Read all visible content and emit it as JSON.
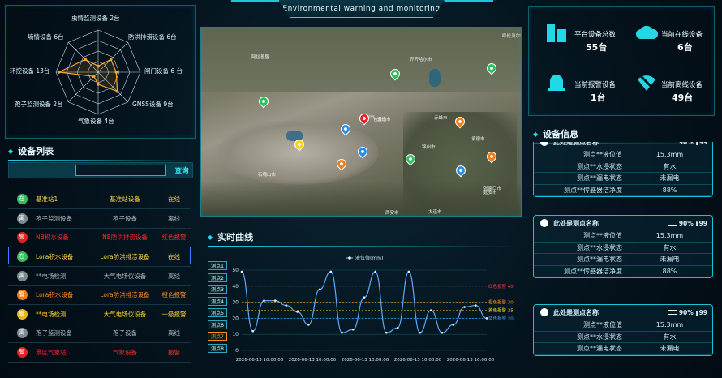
{
  "header": {
    "title": "Environmental warning and monitoring"
  },
  "radar": {
    "labels": [
      "虫情监测设备 2台",
      "防洪排涝设备 6台",
      "闸门设备 6 台",
      "GNSS设备 9台",
      "气象设备 4台",
      "孢子监测设备 2台",
      "环控设备 13台",
      "墒情设备 6台"
    ],
    "values": [
      2,
      6,
      6,
      9,
      4,
      2,
      13,
      6
    ],
    "max": 14
  },
  "device_list": {
    "title": "设备列表",
    "search_button": "查询",
    "search_placeholder": "",
    "rows": [
      {
        "badge": "在",
        "name": "基准站1",
        "type": "基准站设备",
        "status": "在线",
        "color": "#ffd34a",
        "badge_color": "#2fbf5e"
      },
      {
        "badge": "离",
        "name": "孢子监测设备",
        "type": "孢子设备",
        "status": "离线",
        "color": "#a9b6bc",
        "badge_color": "#7d8a90"
      },
      {
        "badge": "警",
        "name": "NB积水设备",
        "type": "NB防洪排涝设备",
        "status": "红色报警",
        "color": "#ff2a2a",
        "badge_color": "#e02424"
      },
      {
        "badge": "在",
        "name": "Lora积水设备",
        "type": "Lora防洪排涝设备",
        "status": "在线",
        "color": "#ffd34a",
        "badge_color": "#2fbf5e"
      },
      {
        "badge": "离",
        "name": "**电场检测",
        "type": "大气电场仪设备",
        "status": "离线",
        "color": "#a9b6bc",
        "badge_color": "#7d8a90"
      },
      {
        "badge": "警",
        "name": "Lora积水设备",
        "type": "Lora防洪排涝设备",
        "status": "橙色报警",
        "color": "#ff8a1e",
        "badge_color": "#f07d18"
      },
      {
        "badge": "警",
        "name": "**电场检测",
        "type": "大气电场仪设备",
        "status": "一级报警",
        "color": "#ffd21e",
        "badge_color": "#e8b81a"
      },
      {
        "badge": "离",
        "name": "孢子监测设备",
        "type": "孢子设备",
        "status": "离线",
        "color": "#a9b6bc",
        "badge_color": "#7d8a90"
      },
      {
        "badge": "警",
        "name": "景区气象站",
        "type": "气象设备",
        "status": "报警",
        "color": "#ff2a2a",
        "badge_color": "#e02424"
      }
    ]
  },
  "map": {
    "labels": [
      "呼伦贝尔市",
      "齐齐哈尔市",
      "赤峰市",
      "通辽市",
      "锦州市",
      "承德市",
      "张家口市",
      "大连市",
      "阿拉善盟",
      "石嘴山市",
      "包头市",
      "西安市",
      "银川市",
      "延安市"
    ]
  },
  "stats": [
    {
      "label": "平台设备总数",
      "value": "55台"
    },
    {
      "label": "当前在线设备",
      "value": "6台"
    },
    {
      "label": "当前报警设备",
      "value": "1台"
    },
    {
      "label": "当前离线设备",
      "value": "49台"
    }
  ],
  "device_info": {
    "title": "设备信息",
    "cards": [
      {
        "name": "此处是测点名称",
        "battery": "90%",
        "signal": "99",
        "rows": [
          [
            "测点**液位值",
            "15.3mm"
          ],
          [
            "测点**水浸状态",
            "有水"
          ],
          [
            "测点**漏电状态",
            "未漏电"
          ],
          [
            "测点**传感器洁净度",
            "88%"
          ]
        ]
      },
      {
        "name": "此处是测点名称",
        "battery": "90%",
        "signal": "99",
        "rows": [
          [
            "测点**液位值",
            "15.3mm"
          ],
          [
            "测点**水浸状态",
            "有水"
          ],
          [
            "测点**漏电状态",
            "未漏电"
          ],
          [
            "测点**传感器洁净度",
            "88%"
          ]
        ]
      },
      {
        "name": "此处是测点名称",
        "battery": "90%",
        "signal": "99",
        "rows": [
          [
            "测点**液位值",
            "15.3mm"
          ],
          [
            "测点**水浸状态",
            "有水"
          ],
          [
            "测点**漏电状态",
            "未漏电"
          ]
        ]
      }
    ]
  },
  "curve": {
    "title": "实时曲线",
    "points": [
      "测点1",
      "测点2",
      "测点3",
      "测点4",
      "测点5",
      "测点6",
      "测点7",
      "测点8"
    ],
    "selected": 6
  },
  "chart_data": {
    "type": "line",
    "series": [
      {
        "name": "液位值(mm)",
        "values": [
          49,
          12,
          31,
          31,
          28,
          24,
          16,
          38,
          49,
          11,
          13,
          33,
          49,
          11,
          14,
          49,
          11,
          25,
          11,
          16,
          27,
          28,
          20
        ]
      }
    ],
    "x_ticks": [
      "2026-06-13 10:00:00",
      "2026-06-13 10:00:00",
      "2026-06-13 10:00:00",
      "2026-06-13 10:00:00",
      "2026-06-13 10:00:00"
    ],
    "ylim": [
      0,
      50
    ],
    "yticks": [
      0,
      10,
      20,
      30,
      40,
      50
    ],
    "thresholds": [
      {
        "label": "红色报警 40",
        "value": 40,
        "color": "#ff3a3a"
      },
      {
        "label": "橙色报警 30",
        "value": 30,
        "color": "#ff8c1a"
      },
      {
        "label": "黄色报警 25",
        "value": 25,
        "color": "#ffd21e"
      },
      {
        "label": "蓝色报警 20",
        "value": 20,
        "color": "#3da2ff"
      }
    ]
  }
}
